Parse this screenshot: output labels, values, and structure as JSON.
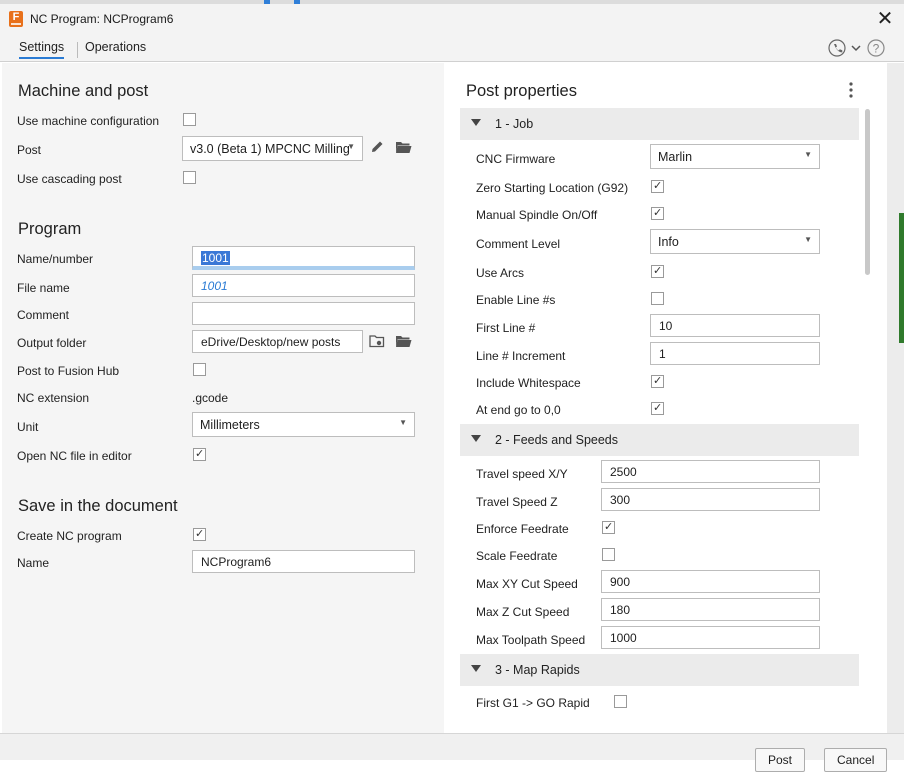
{
  "window": {
    "title": "NC Program: NCProgram6"
  },
  "tabs": [
    {
      "label": "Settings"
    },
    {
      "label": "Operations"
    }
  ],
  "left": {
    "machine": {
      "heading": "Machine and post",
      "use_machine_config_label": "Use machine configuration",
      "use_machine_config_checked": false,
      "post_label": "Post",
      "post_value": "v3.0 (Beta 1) MPCNC Milling",
      "use_cascading_label": "Use cascading post",
      "use_cascading_checked": false
    },
    "program": {
      "heading": "Program",
      "name_label": "Name/number",
      "name_value": "1001",
      "filename_label": "File name",
      "filename_value": "1001",
      "comment_label": "Comment",
      "comment_value": "",
      "output_label": "Output folder",
      "output_value": "eDrive/Desktop/new posts",
      "fusionhub_label": "Post to Fusion Hub",
      "fusionhub_checked": false,
      "ncext_label": "NC extension",
      "ncext_value": ".gcode",
      "unit_label": "Unit",
      "unit_value": "Millimeters",
      "open_editor_label": "Open NC file in editor",
      "open_editor_checked": true
    },
    "save": {
      "heading": "Save in the document",
      "create_label": "Create NC program",
      "create_checked": true,
      "name_label": "Name",
      "name_value": "NCProgram6"
    }
  },
  "right": {
    "heading": "Post properties",
    "sections": [
      {
        "title": "1 - Job"
      },
      {
        "title": "2 - Feeds and Speeds"
      },
      {
        "title": "3 - Map Rapids"
      }
    ],
    "job": {
      "firmware_label": "CNC Firmware",
      "firmware_value": "Marlin",
      "zero_label": "Zero Starting Location (G92)",
      "zero_checked": true,
      "spindle_label": "Manual Spindle On/Off",
      "spindle_checked": true,
      "comment_label": "Comment Level",
      "comment_value": "Info",
      "arcs_label": "Use Arcs",
      "arcs_checked": true,
      "linenum_label": "Enable Line #s",
      "linenum_checked": false,
      "firstline_label": "First Line #",
      "firstline_value": "10",
      "increment_label": "Line # Increment",
      "increment_value": "1",
      "whitespace_label": "Include Whitespace",
      "whitespace_checked": true,
      "atend_label": "At end go to 0,0",
      "atend_checked": true
    },
    "feeds": {
      "travel_xy_label": "Travel speed X/Y",
      "travel_xy_value": "2500",
      "travel_z_label": "Travel Speed Z",
      "travel_z_value": "300",
      "enforce_label": "Enforce Feedrate",
      "enforce_checked": true,
      "scale_label": "Scale Feedrate",
      "scale_checked": false,
      "maxxy_label": "Max XY Cut Speed",
      "maxxy_value": "900",
      "maxz_label": "Max Z Cut Speed",
      "maxz_value": "180",
      "maxtool_label": "Max Toolpath Speed",
      "maxtool_value": "1000"
    },
    "rapids": {
      "first_g1_label": "First G1 -> GO Rapid",
      "first_g1_checked": false
    }
  },
  "footer": {
    "post_label": "Post",
    "cancel_label": "Cancel"
  }
}
